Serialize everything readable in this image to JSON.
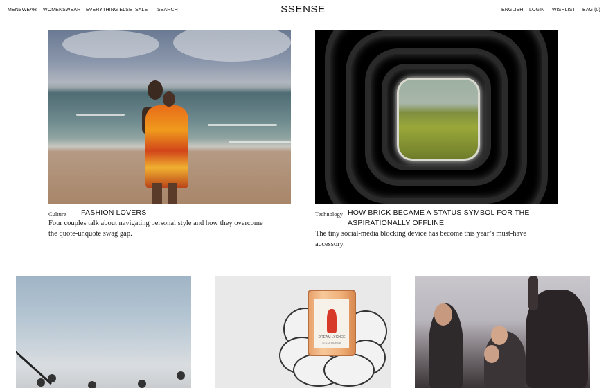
{
  "nav": {
    "left": [
      "MENSWEAR",
      "WOMENSWEAR",
      "EVERYTHING ELSE",
      "SALE",
      "SEARCH"
    ],
    "logo": "SSENSE",
    "right": [
      "ENGLISH",
      "LOGIN",
      "WISHLIST",
      "BAG (0)"
    ]
  },
  "articles": [
    {
      "category": "Culture",
      "title": "FASHION LOVERS",
      "description_lines": [
        "Four couples talk about navigating personal style and how they overcome",
        "the quote-unquote swag gap."
      ]
    },
    {
      "category": "Technology",
      "title_lines": [
        "HOW BRICK BECAME A STATUS SYMBOL FOR THE",
        "ASPIRATIONALLY OFFLINE"
      ],
      "description_lines": [
        "The tiny social-media blocking device has become this year’s must-have",
        "accessory."
      ]
    }
  ],
  "candle": {
    "line1": "DREAM LYCHEE",
    "line2": "D.S. & DURGA"
  },
  "colors": {
    "text": "#111111",
    "background": "#ffffff",
    "vase_red": "#d83a2a"
  }
}
